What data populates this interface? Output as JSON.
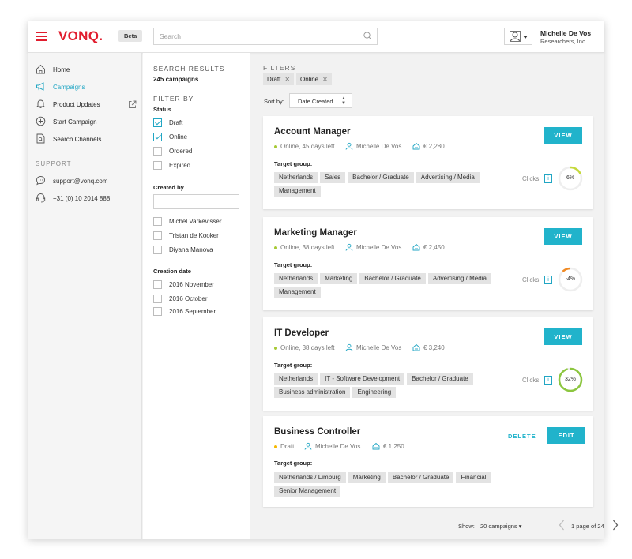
{
  "header": {
    "logo": "VONQ.",
    "beta": "Beta",
    "search_placeholder": "Search",
    "user_name": "Michelle De Vos",
    "user_org": "Researchers, Inc."
  },
  "sidebar": {
    "items": [
      {
        "label": "Home",
        "icon": "home-icon"
      },
      {
        "label": "Campaigns",
        "icon": "megaphone-icon",
        "active": true
      },
      {
        "label": "Product Updates",
        "icon": "bell-icon"
      },
      {
        "label": "Start Campaign",
        "icon": "plus-circle-icon"
      },
      {
        "label": "Search Channels",
        "icon": "document-search-icon"
      }
    ],
    "support_title": "SUPPORT",
    "support_email": "support@vonq.com",
    "support_phone": "+31 (0) 10 2014 888"
  },
  "filters": {
    "results_title": "SEARCH RESULTS",
    "results_count": "245 campaigns",
    "filter_by": "FILTER BY",
    "status_title": "Status",
    "status_options": [
      {
        "label": "Draft",
        "checked": true
      },
      {
        "label": "Online",
        "checked": true
      },
      {
        "label": "Ordered",
        "checked": false
      },
      {
        "label": "Expired",
        "checked": false
      }
    ],
    "created_by_title": "Created by",
    "creators": [
      "Michel Varkevisser",
      "Tristan de Kooker",
      "Diyana Manova"
    ],
    "creation_date_title": "Creation date",
    "dates": [
      "2016 November",
      "2016 October",
      "2016 September"
    ]
  },
  "main": {
    "filters_title": "FILTERS",
    "active_filters": [
      "Draft",
      "Online"
    ],
    "sort_label": "Sort by:",
    "sort_value": "Date Created",
    "view_label": "VIEW",
    "edit_label": "EDIT",
    "delete_label": "DELETE",
    "target_label": "Target group:",
    "clicks_label": "Clicks",
    "campaigns": [
      {
        "title": "Account Manager",
        "status": "Online, 45 days left",
        "owner": "Michelle De Vos",
        "budget": "€ 2,280",
        "tags": [
          "Netherlands",
          "Sales",
          "Bachelor / Graduate",
          "Advertising / Media",
          "Management"
        ],
        "clicks_pct": "6%",
        "clicks_value": 6,
        "gauge_color": "#c5d93b"
      },
      {
        "title": "Marketing Manager",
        "status": "Online, 38 days left",
        "owner": "Michelle De Vos",
        "budget": "€ 2,450",
        "tags": [
          "Netherlands",
          "Marketing",
          "Bachelor / Graduate",
          "Advertising / Media",
          "Management"
        ],
        "clicks_pct": "-4%",
        "clicks_value": -4,
        "gauge_color": "#f08a24"
      },
      {
        "title": "IT Developer",
        "status": "Online, 38 days left",
        "owner": "Michelle De Vos",
        "budget": "€ 3,240",
        "tags": [
          "Netherlands",
          "IT - Software Development",
          "Bachelor / Graduate",
          "Business administration",
          "Engineering"
        ],
        "clicks_pct": "32%",
        "clicks_value": 32,
        "gauge_color": "#8cc63f"
      },
      {
        "title": "Business Controller",
        "status": "Draft",
        "owner": "Michelle De Vos",
        "budget": "€ 1,250",
        "tags": [
          "Netherlands / Limburg",
          "Marketing",
          "Bachelor / Graduate",
          "Financial",
          "Senior Management"
        ]
      }
    ],
    "show_label": "Show:",
    "show_value": "20 campaigns ▾",
    "page_text": "1 page of 24"
  },
  "colors": {
    "brand": "#e11d2e",
    "accent": "#21b3cb",
    "online_dot": "#a8c f33",
    "draft_dot": "#f5b800"
  }
}
